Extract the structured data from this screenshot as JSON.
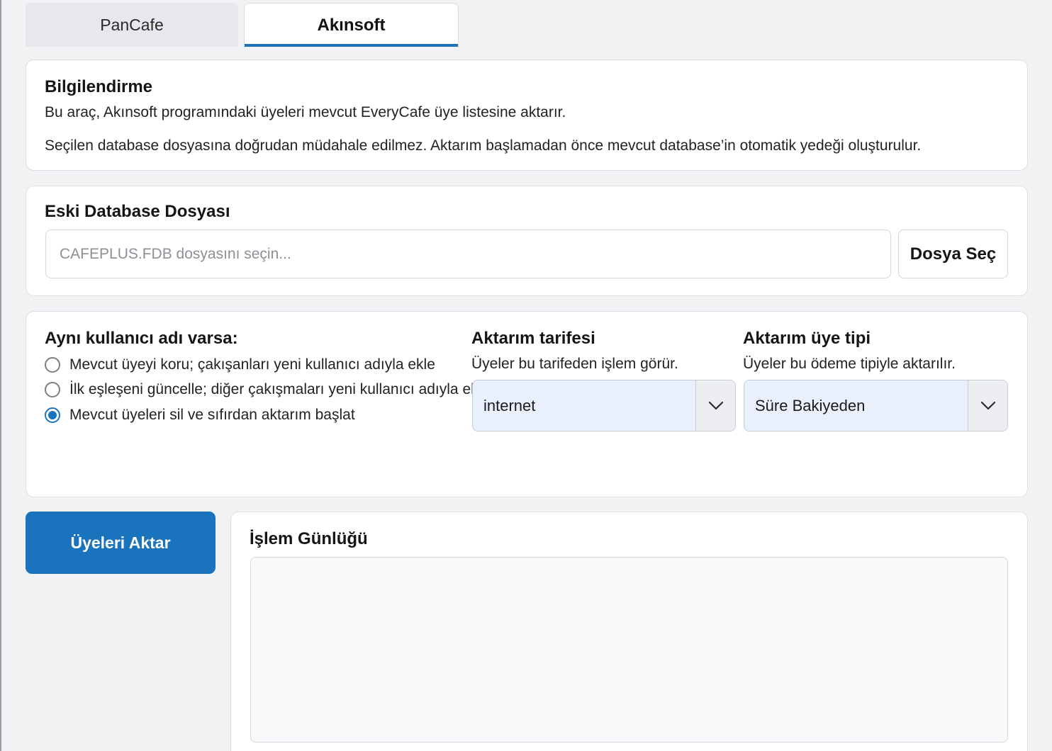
{
  "tabs": [
    {
      "label": "PanCafe",
      "active": false
    },
    {
      "label": "Akınsoft",
      "active": true
    }
  ],
  "info": {
    "title": "Bilgilendirme",
    "line1": "Bu araç, Akınsoft programındaki üyeleri mevcut EveryCafe üye listesine aktarır.",
    "line2": "Seçilen database dosyasına doğrudan müdahale edilmez. Aktarım başlamadan önce mevcut database’in otomatik yedeği oluşturulur."
  },
  "file": {
    "title": "Eski Database Dosyası",
    "placeholder": "CAFEPLUS.FDB dosyasını seçin...",
    "value": "",
    "button_label": "Dosya Seç"
  },
  "duplicate": {
    "title": "Aynı kullanıcı adı varsa:",
    "options": [
      {
        "label": "Mevcut üyeyi koru; çakışanları yeni kullanıcı adıyla ekle",
        "checked": false
      },
      {
        "label": "İlk eşleşeni güncelle; diğer çakışmaları yeni kullanıcı adıyla ekle",
        "checked": false
      },
      {
        "label": "Mevcut üyeleri sil ve sıfırdan aktarım başlat",
        "checked": true
      }
    ]
  },
  "tariff": {
    "title": "Aktarım tarifesi",
    "subtitle": "Üyeler bu tarifeden işlem görür.",
    "selected": "internet"
  },
  "member_type": {
    "title": "Aktarım üye tipi",
    "subtitle": "Üyeler bu ödeme tipiyle aktarılır.",
    "selected": "Süre Bakiyeden"
  },
  "action": {
    "label": "Üyeleri Aktar"
  },
  "log": {
    "title": "İşlem Günlüğü",
    "content": ""
  },
  "colors": {
    "accent": "#1a73bd",
    "select_bg": "#e9f0fb",
    "page_bg": "#f1f2f4"
  },
  "icons": {
    "select_arrow": "chevron-down-icon"
  }
}
